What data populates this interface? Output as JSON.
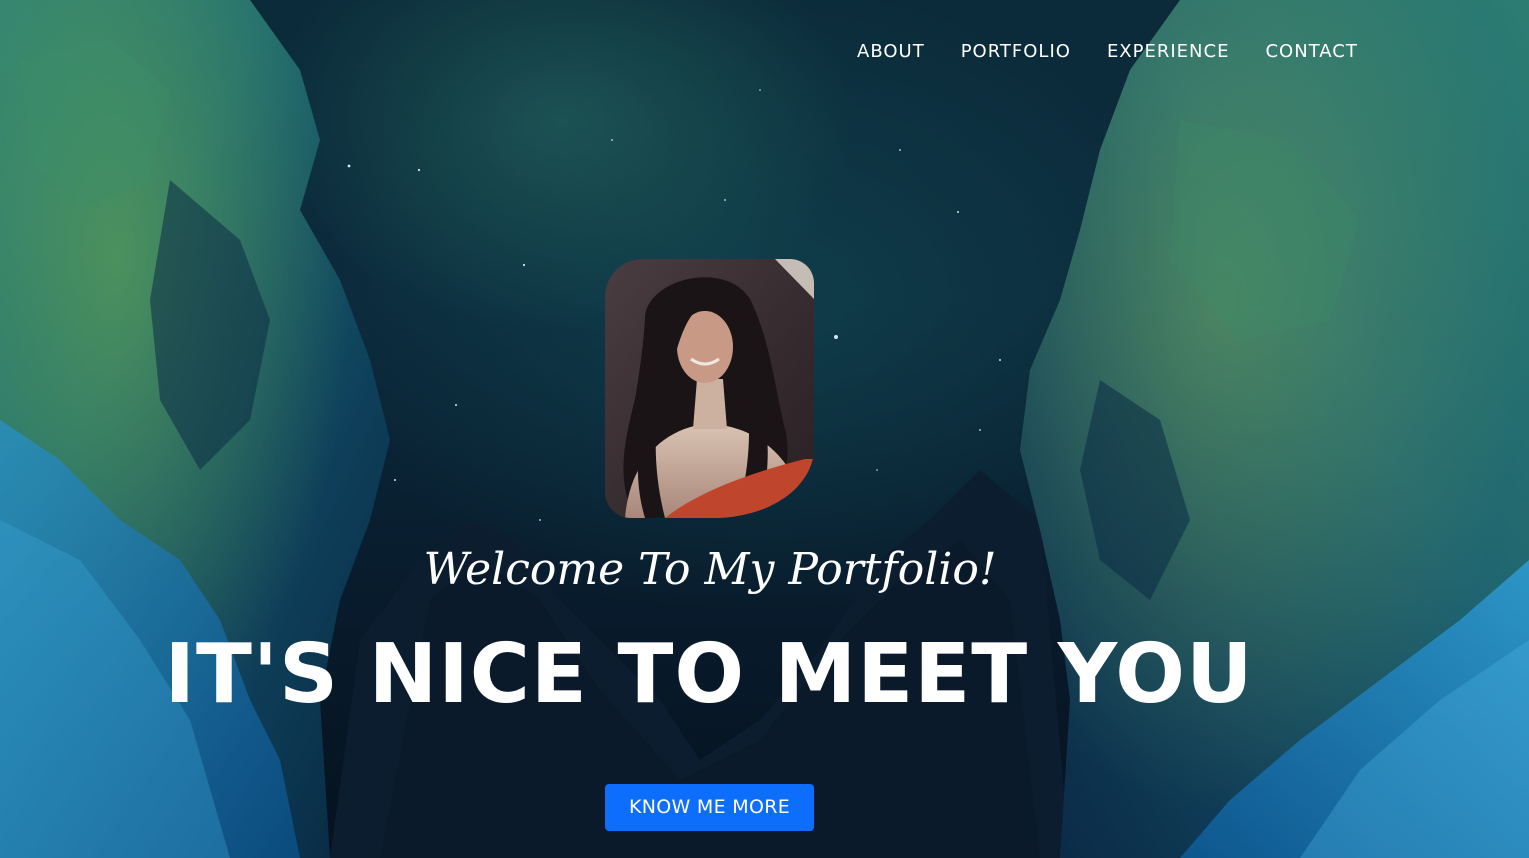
{
  "nav": {
    "items": [
      {
        "label": "ABOUT"
      },
      {
        "label": "PORTFOLIO"
      },
      {
        "label": "EXPERIENCE"
      },
      {
        "label": "CONTACT"
      }
    ]
  },
  "hero": {
    "welcome": "Welcome To My Portfolio!",
    "headline": "IT'S NICE TO MEET YOU",
    "cta_label": "KNOW ME MORE",
    "avatar_icon": "profile-photo"
  },
  "colors": {
    "cta_background": "#0d6efd",
    "text": "#ffffff",
    "sky": "#0b2b3a"
  }
}
